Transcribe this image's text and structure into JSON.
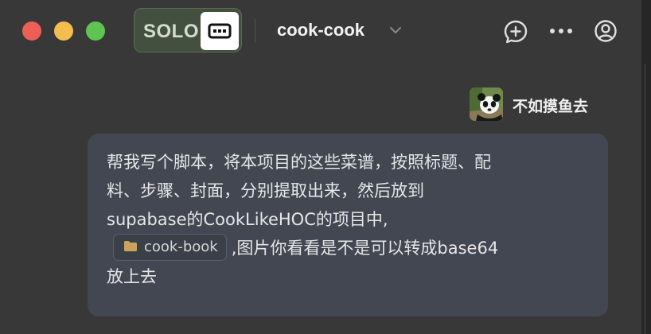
{
  "window": {
    "mode_badge": "SOLO",
    "project_name": "cook-cook",
    "traffic_lights": {
      "close": "#ec5f57",
      "minimize": "#f3bd4f",
      "zoom": "#5fc453"
    },
    "icons": [
      "solo-mode-icon",
      "chevron-down-icon",
      "new-chat-icon",
      "more-icon",
      "account-icon"
    ]
  },
  "user": {
    "name": "不如摸鱼去",
    "avatar": "panda-avatar"
  },
  "message": {
    "line1": "帮我写个脚本，将本项目的这些菜谱，按照标题、配",
    "line2": "料、步骤、封面，分别提取出来，然后放到",
    "line3": "supabase的CookLikeHOC的项目中,",
    "chip_label": "cook-book",
    "chip_icon": "folder-icon",
    "line4_after": ",图片你看看是不是可以转成base64",
    "line5": "放上去"
  }
}
